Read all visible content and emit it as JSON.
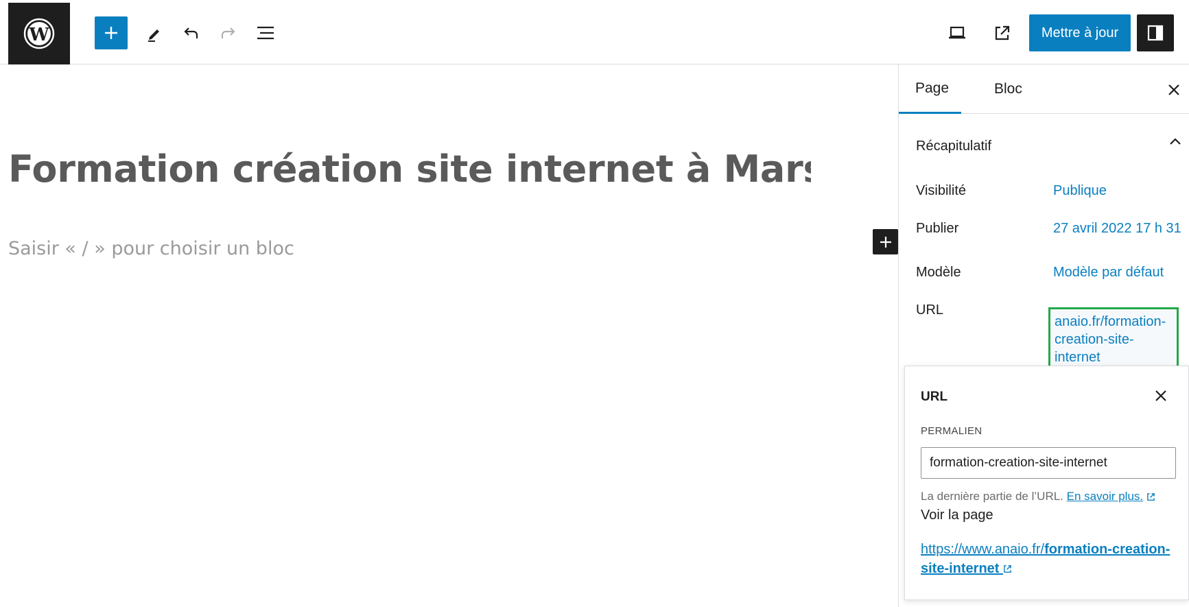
{
  "toolbar": {
    "update_label": "Mettre à jour"
  },
  "editor": {
    "title": "Formation création site internet à Marseille",
    "placeholder": "Saisir « / » pour choisir un bloc"
  },
  "sidebar": {
    "tabs": [
      {
        "label": "Page"
      },
      {
        "label": "Bloc"
      }
    ],
    "panel_title": "Récapitulatif",
    "rows": [
      {
        "label": "Visibilité",
        "value": "Publique"
      },
      {
        "label": "Publier",
        "value": "27 avril 2022 17 h 31"
      },
      {
        "label": "Modèle",
        "value": "Modèle par défaut"
      },
      {
        "label": "URL",
        "value_line1": "anaio.fr/formation-",
        "value_line2": "creation-site-internet"
      }
    ]
  },
  "url_popover": {
    "title": "URL",
    "permalink_label": "PERMALIEN",
    "slug": "formation-creation-site-internet",
    "help_text": "La dernière partie de l’URL.",
    "help_link": "En savoir plus.",
    "view_label": "Voir la page",
    "link_prefix": "https://www.anaio.fr/",
    "link_slug_line1": "formation-creation-",
    "link_slug_line2": "site-internet"
  },
  "colors": {
    "accent": "#0a7fc0",
    "dark": "#1e1e1e",
    "highlight": "#23a848"
  },
  "icons": [
    "wordpress-logo",
    "plus-icon",
    "pencil-icon",
    "undo-icon",
    "redo-icon",
    "list-view-icon",
    "preview-icon",
    "external-link-icon",
    "sidebar-toggle-icon",
    "close-icon",
    "chevron-up-icon"
  ]
}
